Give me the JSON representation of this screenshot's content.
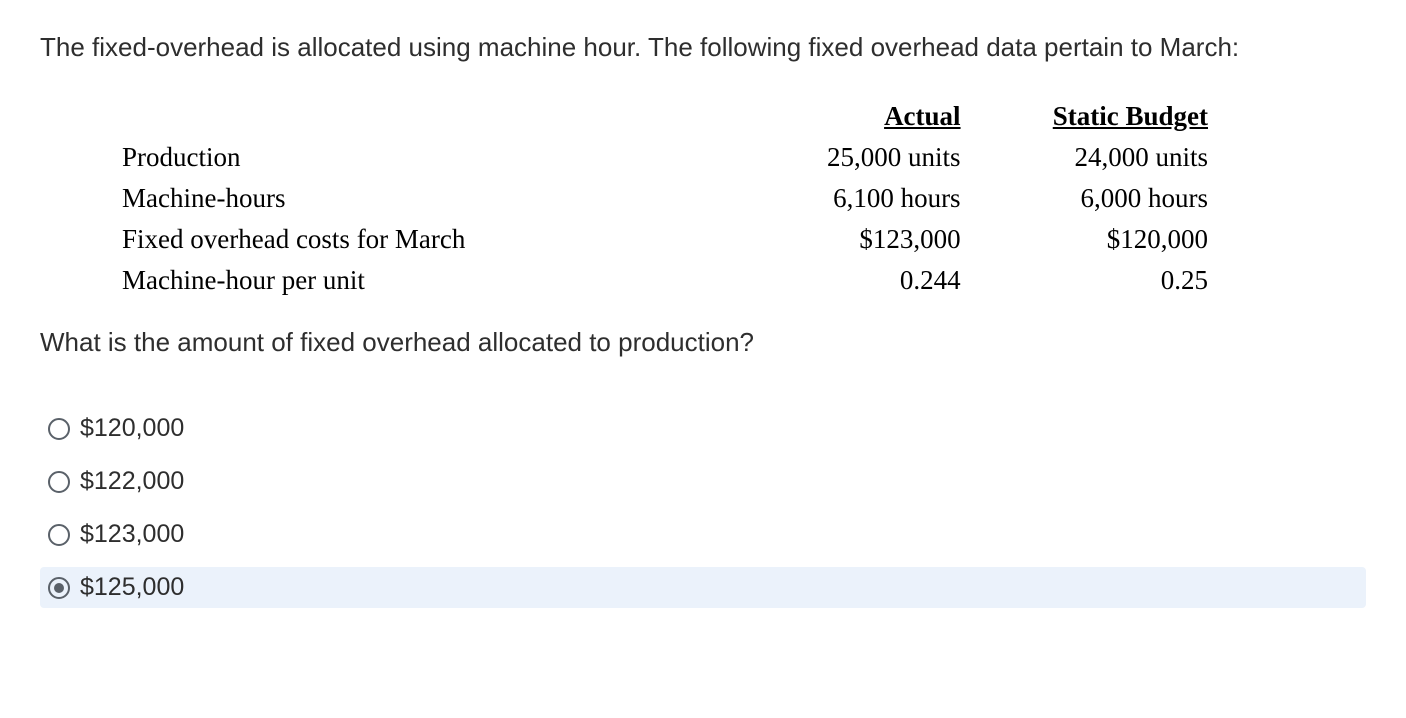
{
  "question": {
    "intro": "The fixed-overhead is allocated using machine hour. The following fixed overhead data pertain to March:",
    "followup": "What is the amount of fixed overhead allocated to production?"
  },
  "table": {
    "headers": {
      "actual": "Actual",
      "budget": "Static Budget"
    },
    "rows": [
      {
        "label": "Production",
        "actual": "25,000 units",
        "budget": "24,000 units"
      },
      {
        "label": "Machine-hours",
        "actual": "6,100 hours",
        "budget": "6,000 hours"
      },
      {
        "label": "Fixed overhead costs for March",
        "actual": "$123,000",
        "budget": "$120,000"
      },
      {
        "label": "Machine-hour per unit",
        "actual": "0.244",
        "budget": "0.25"
      }
    ]
  },
  "options": [
    {
      "label": "$120,000",
      "selected": false
    },
    {
      "label": "$122,000",
      "selected": false
    },
    {
      "label": "$123,000",
      "selected": false
    },
    {
      "label": "$125,000",
      "selected": true
    }
  ]
}
